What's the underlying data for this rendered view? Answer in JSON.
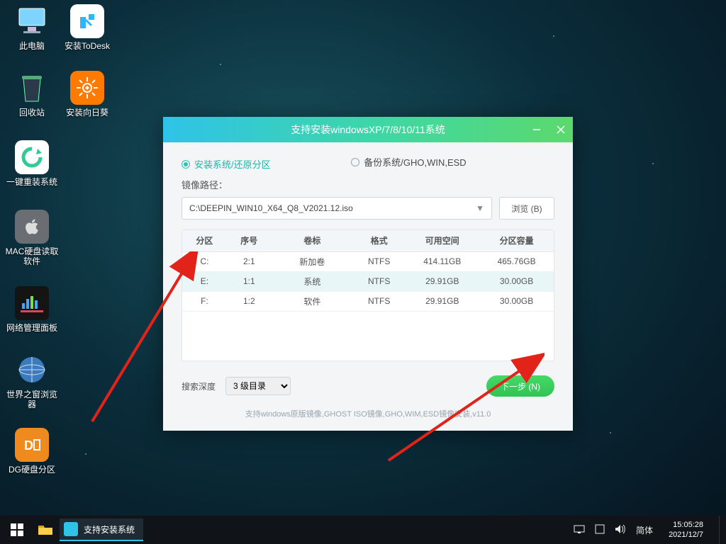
{
  "desktop_icons": [
    {
      "id": "this-pc",
      "label": "此电脑"
    },
    {
      "id": "todesk",
      "label": "安装ToDesk"
    },
    {
      "id": "recycle",
      "label": "回收站"
    },
    {
      "id": "sunflower",
      "label": "安装向日葵"
    },
    {
      "id": "reinstall",
      "label": "一键重装系统"
    },
    {
      "id": "macdisk",
      "label": "MAC硬盘读取软件"
    },
    {
      "id": "netmgr",
      "label": "网络管理面板"
    },
    {
      "id": "browser",
      "label": "世界之窗浏览器"
    },
    {
      "id": "dg",
      "label": "DG硬盘分区"
    }
  ],
  "dialog": {
    "title": "支持安装windowsXP/7/8/10/11系统",
    "tab_install": "安装系统/还原分区",
    "tab_backup": "备份系统/GHO,WIN,ESD",
    "path_label": "镜像路径：",
    "path_value": "C:\\DEEPIN_WIN10_X64_Q8_V2021.12.iso",
    "browse": "浏览 (B)",
    "table_headers": [
      "分区",
      "序号",
      "卷标",
      "格式",
      "可用空间",
      "分区容量"
    ],
    "rows": [
      {
        "p": "C:",
        "n": "2:1",
        "v": "新加卷",
        "f": "NTFS",
        "free": "414.11GB",
        "cap": "465.76GB"
      },
      {
        "p": "E:",
        "n": "1:1",
        "v": "系统",
        "f": "NTFS",
        "free": "29.91GB",
        "cap": "30.00GB"
      },
      {
        "p": "F:",
        "n": "1:2",
        "v": "软件",
        "f": "NTFS",
        "free": "29.91GB",
        "cap": "30.00GB"
      }
    ],
    "selected_row": 1,
    "depth_label": "搜索深度",
    "depth_value": "3 级目录",
    "next": "下一步 (N)",
    "support": "支持windows原版镜像,GHOST ISO镜像,GHO,WIM,ESD镜像安装,v11.0"
  },
  "taskbar": {
    "running": "支持安装系统",
    "ime": "简体",
    "time": "15:05:28",
    "date": "2021/12/7"
  }
}
